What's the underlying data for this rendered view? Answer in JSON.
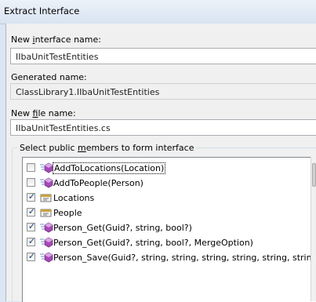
{
  "window": {
    "title": "Extract Interface"
  },
  "form": {
    "interface_name": {
      "label_pre": "New ",
      "label_ul": "i",
      "label_post": "nterface name:",
      "value": "IIbaUnitTestEntities"
    },
    "generated_name": {
      "label": "Generated name:",
      "value": "ClassLibrary1.IIbaUnitTestEntities"
    },
    "file_name": {
      "label_pre": "New ",
      "label_ul": "f",
      "label_post": "ile name:",
      "value": "IIbaUnitTestEntities.cs"
    }
  },
  "members": {
    "caption_pre": "Select public ",
    "caption_ul": "m",
    "caption_post": "embers to form interface",
    "items": [
      {
        "label": "AddToLocations(Location)",
        "checked": false,
        "icon": "method-icon",
        "focused": true
      },
      {
        "label": "AddToPeople(Person)",
        "checked": false,
        "icon": "method-icon"
      },
      {
        "label": "Locations",
        "checked": true,
        "icon": "property-icon"
      },
      {
        "label": "People",
        "checked": true,
        "icon": "property-icon"
      },
      {
        "label": "Person_Get(Guid?, string, bool?)",
        "checked": true,
        "icon": "method-icon"
      },
      {
        "label": "Person_Get(Guid?, string, bool?, MergeOption)",
        "checked": true,
        "icon": "method-icon"
      },
      {
        "label": "Person_Save(Guid?, string, string, string, string, string, string, s",
        "checked": true,
        "icon": "method-icon"
      }
    ]
  },
  "colors": {
    "method_icon": "#a64ab8",
    "property_icon": "#c9a23c",
    "check": "#1e3c7a"
  }
}
